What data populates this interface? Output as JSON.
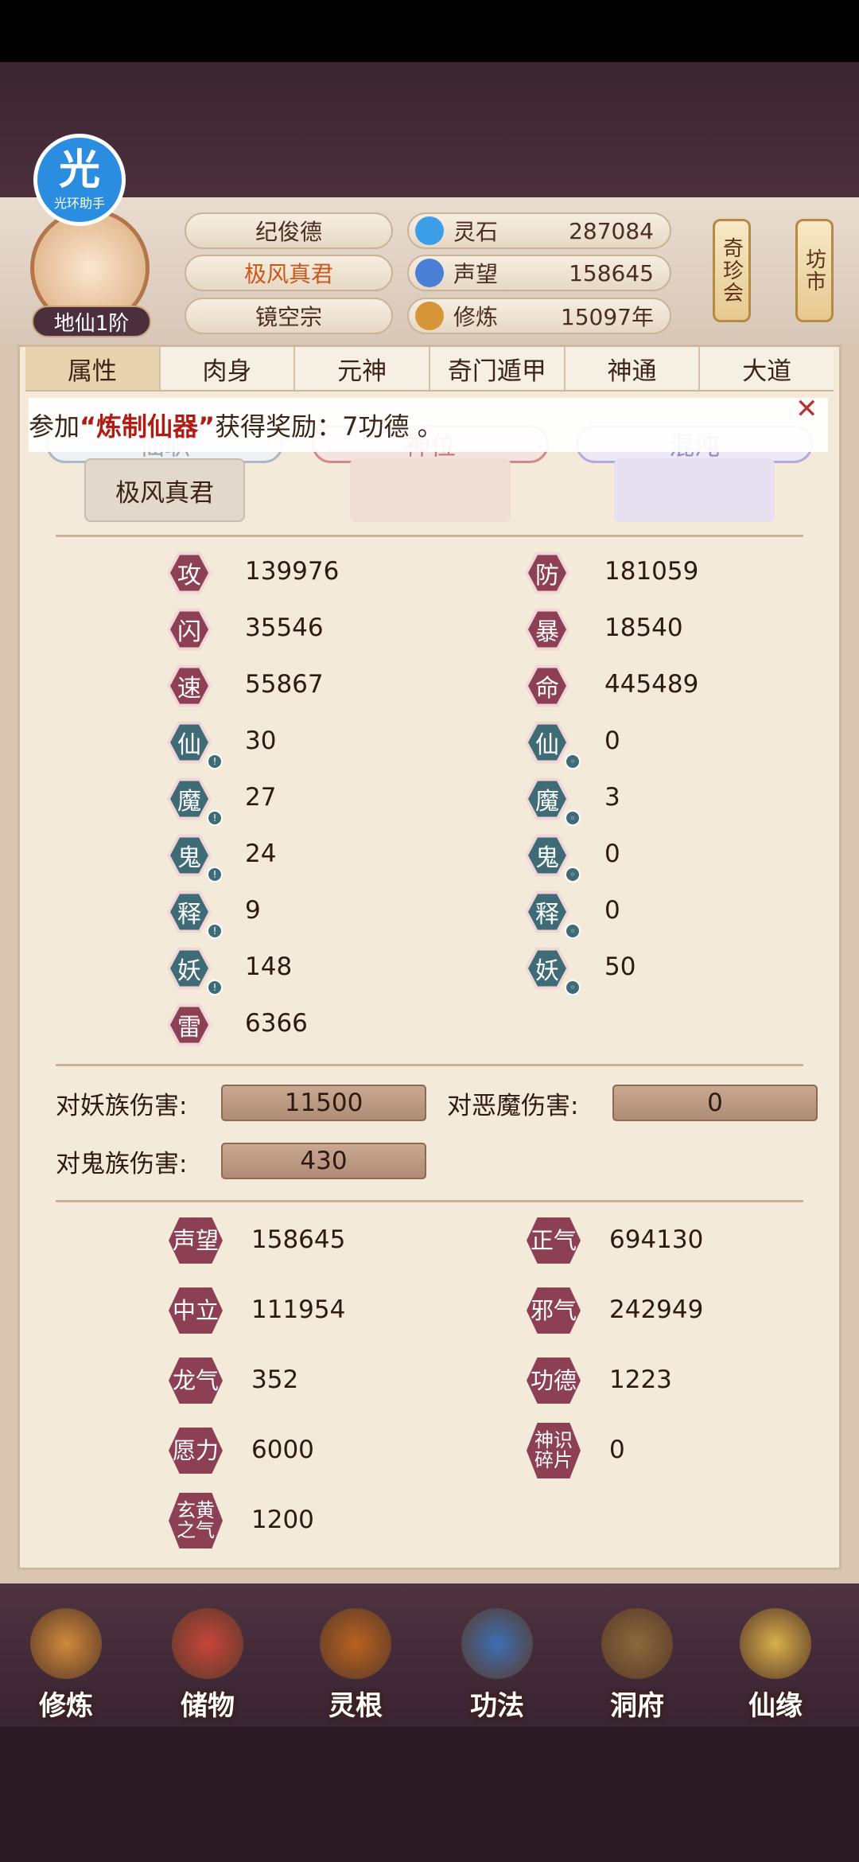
{
  "halo": {
    "glyph": "光",
    "caption": "光环助手"
  },
  "player": {
    "rank": "地仙1阶"
  },
  "header": {
    "name": "纪俊德",
    "title": "极风真君",
    "sect": "镜空宗",
    "resources": [
      {
        "label": "灵石",
        "value": "287084",
        "icon": "spirit-stone-icon",
        "color": "#3a9ee8"
      },
      {
        "label": "声望",
        "value": "158645",
        "icon": "reputation-icon",
        "color": "#4a7fd6"
      },
      {
        "label": "修炼",
        "value": "15097年",
        "icon": "cultivation-icon",
        "color": "#d7953a"
      }
    ],
    "side_buttons": [
      "奇珍会",
      "坊市"
    ]
  },
  "tabs": [
    "属性",
    "肉身",
    "元神",
    "奇门遁甲",
    "神通",
    "大道"
  ],
  "active_tab": 0,
  "notice": {
    "prefix": "参加",
    "highlight": "“炼制仙器”",
    "suffix": "获得奖励：7功德 。"
  },
  "subtabs": {
    "items": [
      "仙职",
      "神位",
      "混沌"
    ],
    "values": [
      "极风真君",
      "",
      ""
    ]
  },
  "stats_left": [
    {
      "icon": "攻",
      "value": "139976"
    },
    {
      "icon": "闪",
      "value": "35546"
    },
    {
      "icon": "速",
      "value": "55867"
    },
    {
      "icon": "仙",
      "value": "30"
    },
    {
      "icon": "魔",
      "value": "27"
    },
    {
      "icon": "鬼",
      "value": "24"
    },
    {
      "icon": "释",
      "value": "9"
    },
    {
      "icon": "妖",
      "value": "148"
    },
    {
      "icon": "雷",
      "value": "6366"
    }
  ],
  "stats_right": [
    {
      "icon": "防",
      "value": "181059"
    },
    {
      "icon": "暴",
      "value": "18540"
    },
    {
      "icon": "命",
      "value": "445489"
    },
    {
      "icon": "仙",
      "value": "0"
    },
    {
      "icon": "魔",
      "value": "3"
    },
    {
      "icon": "鬼",
      "value": "0"
    },
    {
      "icon": "释",
      "value": "0"
    },
    {
      "icon": "妖",
      "value": "50"
    }
  ],
  "damage": [
    {
      "label": "对妖族伤害:",
      "value": "11500"
    },
    {
      "label": "对恶魔伤害:",
      "value": "0"
    },
    {
      "label": "对鬼族伤害:",
      "value": "430"
    }
  ],
  "reputation": [
    {
      "icon": "声望",
      "value": "158645"
    },
    {
      "icon": "正气",
      "value": "694130"
    },
    {
      "icon": "中立",
      "value": "111954"
    },
    {
      "icon": "邪气",
      "value": "242949"
    },
    {
      "icon": "龙气",
      "value": "352"
    },
    {
      "icon": "功德",
      "value": "1223"
    },
    {
      "icon": "愿力",
      "value": "6000"
    },
    {
      "icon": "神识碎片",
      "value": "0"
    },
    {
      "icon": "玄黄之气",
      "value": "1200"
    }
  ],
  "nav": [
    {
      "label": "修炼",
      "icon": "cultivate-icon",
      "color": "#d08a3a"
    },
    {
      "label": "储物",
      "icon": "storage-bag-icon",
      "color": "#c8453a"
    },
    {
      "label": "灵根",
      "icon": "spirit-root-icon",
      "color": "#b8621e"
    },
    {
      "label": "功法",
      "icon": "technique-book-icon",
      "color": "#3c6fb3"
    },
    {
      "label": "洞府",
      "icon": "cave-dwelling-icon",
      "color": "#8a6a3a"
    },
    {
      "label": "仙缘",
      "icon": "immortal-fate-icon",
      "color": "#d8b04a"
    }
  ]
}
